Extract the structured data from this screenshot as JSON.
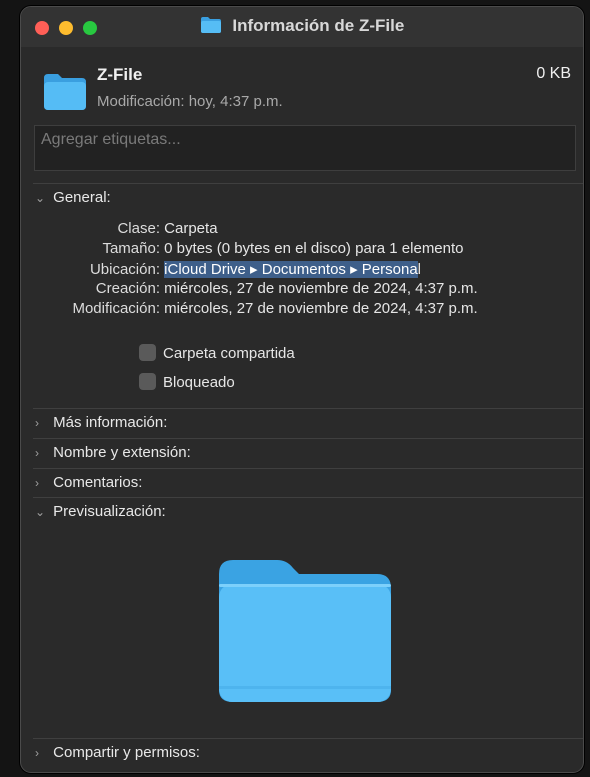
{
  "window": {
    "title": "Información de Z-File"
  },
  "header": {
    "name": "Z-File",
    "modified": "Modificación: hoy, 4:37 p.m.",
    "size": "0 KB"
  },
  "tags": {
    "placeholder": "Agregar etiquetas..."
  },
  "general": {
    "heading": "General:",
    "rows": [
      {
        "label": "Clase:",
        "value": "Carpeta"
      },
      {
        "label": "Tamaño:",
        "value": "0 bytes (0 bytes en el disco) para 1 elemento"
      },
      {
        "label": "Ubicación:",
        "value_highlight": "iCloud Drive ▸ Documentos ▸ Persona",
        "value_rest": "l"
      },
      {
        "label": "Creación:",
        "value": "miércoles, 27 de noviembre de 2024, 4:37 p.m."
      },
      {
        "label": "Modificación:",
        "value": "miércoles, 27 de noviembre de 2024, 4:37 p.m."
      }
    ],
    "checkboxes": [
      {
        "label": "Carpeta compartida",
        "checked": false
      },
      {
        "label": "Bloqueado",
        "checked": false
      }
    ]
  },
  "sections": {
    "more_info": "Más información:",
    "name_ext": "Nombre y extensión:",
    "comments": "Comentarios:",
    "preview": "Previsualización:",
    "sharing": "Compartir y permisos:"
  },
  "icons": {
    "folder": "folder-icon",
    "disclosure_open": "chevron-down-icon",
    "disclosure_closed": "chevron-right-icon"
  },
  "colors": {
    "folder_blue": "#4fb6f2",
    "selection": "#3e5f8a"
  }
}
